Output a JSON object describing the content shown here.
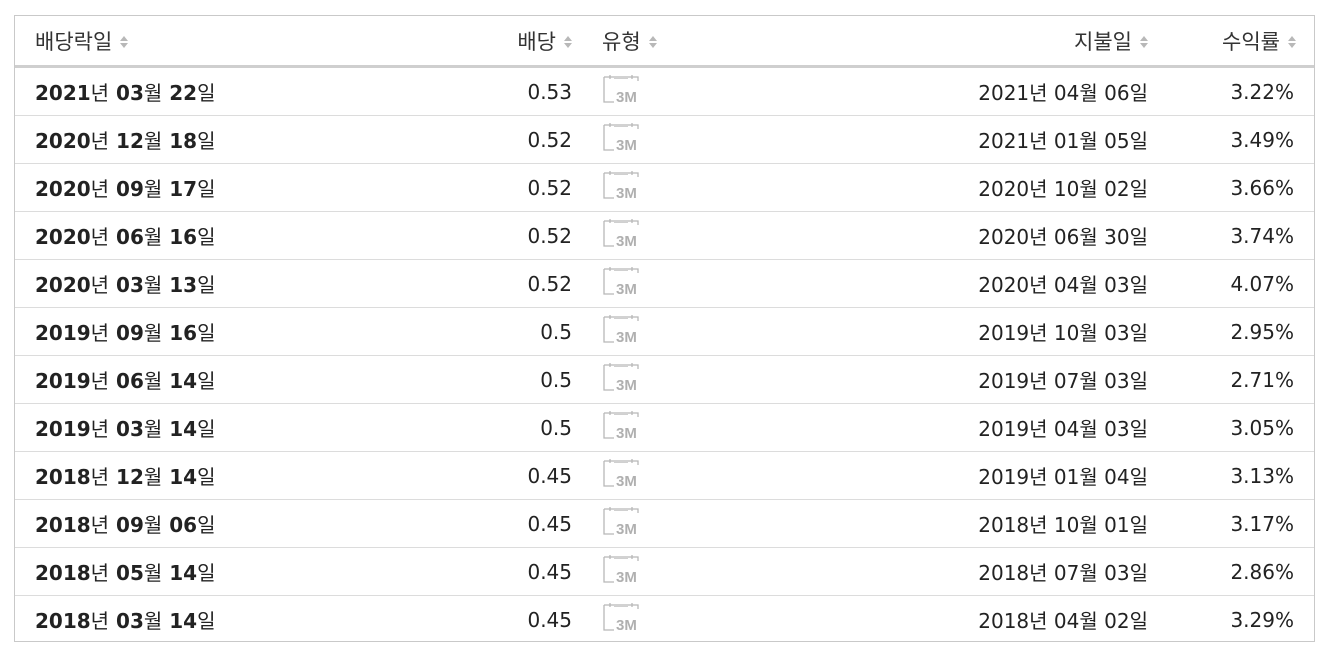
{
  "table": {
    "headers": {
      "ex_date": "배당락일",
      "amount": "배당",
      "type": "유형",
      "pay_date": "지불일",
      "yield": "수익률"
    },
    "rows": [
      {
        "ex_y": "2021",
        "ex_m": "03",
        "ex_d": "22",
        "amount": "0.53",
        "type": "3M",
        "pay_y": "2021",
        "pay_m": "04",
        "pay_d": "06",
        "yield": "3.22%"
      },
      {
        "ex_y": "2020",
        "ex_m": "12",
        "ex_d": "18",
        "amount": "0.52",
        "type": "3M",
        "pay_y": "2021",
        "pay_m": "01",
        "pay_d": "05",
        "yield": "3.49%"
      },
      {
        "ex_y": "2020",
        "ex_m": "09",
        "ex_d": "17",
        "amount": "0.52",
        "type": "3M",
        "pay_y": "2020",
        "pay_m": "10",
        "pay_d": "02",
        "yield": "3.66%"
      },
      {
        "ex_y": "2020",
        "ex_m": "06",
        "ex_d": "16",
        "amount": "0.52",
        "type": "3M",
        "pay_y": "2020",
        "pay_m": "06",
        "pay_d": "30",
        "yield": "3.74%"
      },
      {
        "ex_y": "2020",
        "ex_m": "03",
        "ex_d": "13",
        "amount": "0.52",
        "type": "3M",
        "pay_y": "2020",
        "pay_m": "04",
        "pay_d": "03",
        "yield": "4.07%"
      },
      {
        "ex_y": "2019",
        "ex_m": "09",
        "ex_d": "16",
        "amount": "0.5",
        "type": "3M",
        "pay_y": "2019",
        "pay_m": "10",
        "pay_d": "03",
        "yield": "2.95%"
      },
      {
        "ex_y": "2019",
        "ex_m": "06",
        "ex_d": "14",
        "amount": "0.5",
        "type": "3M",
        "pay_y": "2019",
        "pay_m": "07",
        "pay_d": "03",
        "yield": "2.71%"
      },
      {
        "ex_y": "2019",
        "ex_m": "03",
        "ex_d": "14",
        "amount": "0.5",
        "type": "3M",
        "pay_y": "2019",
        "pay_m": "04",
        "pay_d": "03",
        "yield": "3.05%"
      },
      {
        "ex_y": "2018",
        "ex_m": "12",
        "ex_d": "14",
        "amount": "0.45",
        "type": "3M",
        "pay_y": "2019",
        "pay_m": "01",
        "pay_d": "04",
        "yield": "3.13%"
      },
      {
        "ex_y": "2018",
        "ex_m": "09",
        "ex_d": "06",
        "amount": "0.45",
        "type": "3M",
        "pay_y": "2018",
        "pay_m": "10",
        "pay_d": "01",
        "yield": "3.17%"
      },
      {
        "ex_y": "2018",
        "ex_m": "05",
        "ex_d": "14",
        "amount": "0.45",
        "type": "3M",
        "pay_y": "2018",
        "pay_m": "07",
        "pay_d": "03",
        "yield": "2.86%"
      },
      {
        "ex_y": "2018",
        "ex_m": "03",
        "ex_d": "14",
        "amount": "0.45",
        "type": "3M",
        "pay_y": "2018",
        "pay_m": "04",
        "pay_d": "02",
        "yield": "3.29%"
      }
    ]
  },
  "units": {
    "year": "년",
    "month": "월",
    "day": "일"
  },
  "icons": {
    "sort": "sort-arrows-icon",
    "type": "calendar-icon"
  },
  "colors": {
    "border": "#c9c9c9",
    "header_rule": "#cfcfcf",
    "icon": "#b8b8b8"
  }
}
